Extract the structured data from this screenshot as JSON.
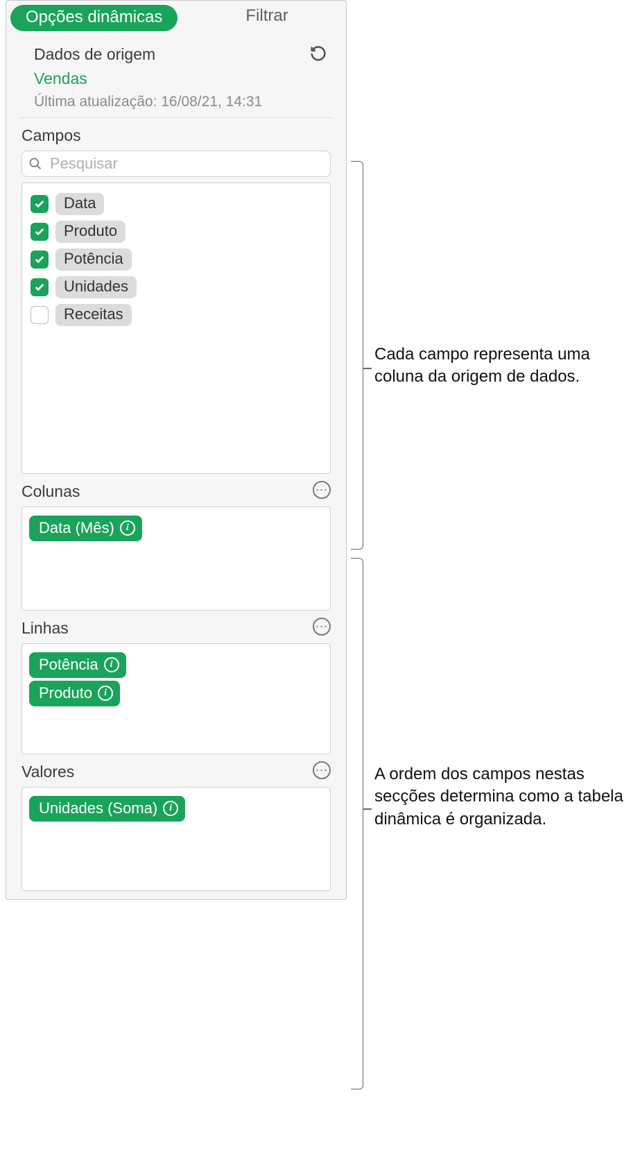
{
  "tabs": {
    "active": "Opções dinâmicas",
    "inactive": "Filtrar"
  },
  "source": {
    "heading": "Dados de origem",
    "name": "Vendas",
    "updated": "Última atualização: 16/08/21, 14:31"
  },
  "fields": {
    "heading": "Campos",
    "search_placeholder": "Pesquisar",
    "items": [
      {
        "label": "Data",
        "checked": true
      },
      {
        "label": "Produto",
        "checked": true
      },
      {
        "label": "Potência",
        "checked": true
      },
      {
        "label": "Unidades",
        "checked": true
      },
      {
        "label": "Receitas",
        "checked": false
      }
    ]
  },
  "columns": {
    "heading": "Colunas",
    "items": [
      {
        "label": "Data (Mês)"
      }
    ]
  },
  "rows": {
    "heading": "Linhas",
    "items": [
      {
        "label": "Potência"
      },
      {
        "label": "Produto"
      }
    ]
  },
  "values": {
    "heading": "Valores",
    "items": [
      {
        "label": "Unidades (Soma)"
      }
    ]
  },
  "callouts": {
    "c1": "Cada campo representa uma coluna da origem de dados.",
    "c2": "A ordem dos campos nestas secções determina como a tabela dinâmica é organizada."
  }
}
